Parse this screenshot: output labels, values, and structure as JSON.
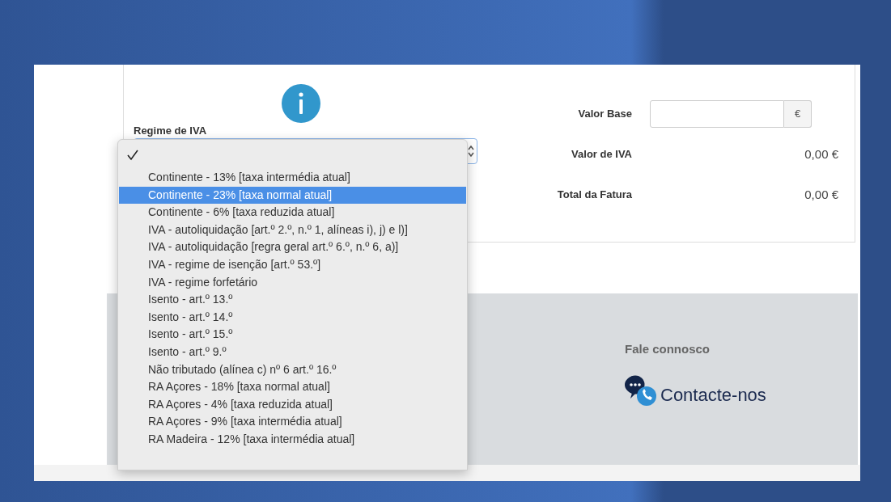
{
  "vat_regime": {
    "label": "Regime de IVA",
    "options": [
      {
        "checked": true
      },
      {
        "label": "Continente - 13% [taxa intermédia atual]",
        "checked": false,
        "selected": false
      },
      {
        "label": "Continente - 23% [taxa normal atual]",
        "checked": false,
        "selected": true
      },
      {
        "label": "Continente - 6% [taxa reduzida atual]",
        "checked": false,
        "selected": false
      },
      {
        "label": "IVA - autoliquidação [art.º 2.º, n.º 1, alíneas i), j) e l)]",
        "checked": false,
        "selected": false
      },
      {
        "label": "IVA - autoliquidação [regra geral art.º 6.º, n.º 6, a)]",
        "checked": false,
        "selected": false
      },
      {
        "label": "IVA - regime de isenção [art.º 53.º]",
        "checked": false,
        "selected": false
      },
      {
        "label": "IVA - regime forfetário",
        "checked": false,
        "selected": false
      },
      {
        "label": "Isento - art.º 13.º",
        "checked": false,
        "selected": false
      },
      {
        "label": "Isento - art.º 14.º",
        "checked": false,
        "selected": false
      },
      {
        "label": "Isento - art.º 15.º",
        "checked": false,
        "selected": false
      },
      {
        "label": "Isento - art.º 9.º",
        "checked": false,
        "selected": false
      },
      {
        "label": "Não tributado (alínea c) nº 6 art.º 16.º",
        "checked": false,
        "selected": false
      },
      {
        "label": "RA Açores - 18% [taxa normal atual]",
        "checked": false,
        "selected": false
      },
      {
        "label": "RA Açores - 4% [taxa reduzida atual]",
        "checked": false,
        "selected": false
      },
      {
        "label": "RA Açores - 9% [taxa intermédia atual]",
        "checked": false,
        "selected": false
      },
      {
        "label": "RA Madeira - 12% [taxa intermédia atual]",
        "checked": false,
        "selected": false
      }
    ]
  },
  "summary": {
    "base": {
      "label": "Valor Base",
      "currency": "€"
    },
    "rows": [
      {
        "label": "Valor de IVA",
        "value": "0,00 €"
      },
      {
        "label": "Total da Fatura",
        "value": "0,00 €"
      }
    ]
  },
  "footer": {
    "heading": "Fale connosco",
    "contact_link": "Contacte-nos"
  }
}
